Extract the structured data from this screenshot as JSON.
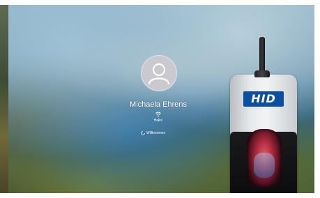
{
  "lock_screen": {
    "user_name": "Michaela Ehrens",
    "hello_text": "Hallo!",
    "welcome_text": "Willkommen",
    "avatar_icon": "user-icon",
    "fingerprint_icon": "fingerprint-icon",
    "spinner_icon": "spinner-icon"
  },
  "device": {
    "brand_label": "HID",
    "brand_color": "#0b4fa3"
  }
}
